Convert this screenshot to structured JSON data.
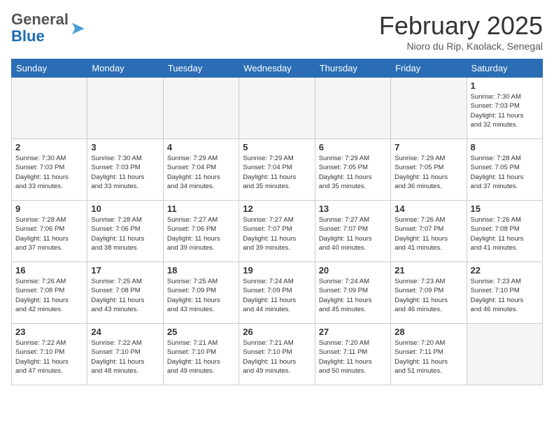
{
  "header": {
    "logo_general": "General",
    "logo_blue": "Blue",
    "month_title": "February 2025",
    "location": "Nioro du Rip, Kaolack, Senegal"
  },
  "weekdays": [
    "Sunday",
    "Monday",
    "Tuesday",
    "Wednesday",
    "Thursday",
    "Friday",
    "Saturday"
  ],
  "weeks": [
    [
      {
        "day": "",
        "info": ""
      },
      {
        "day": "",
        "info": ""
      },
      {
        "day": "",
        "info": ""
      },
      {
        "day": "",
        "info": ""
      },
      {
        "day": "",
        "info": ""
      },
      {
        "day": "",
        "info": ""
      },
      {
        "day": "1",
        "info": "Sunrise: 7:30 AM\nSunset: 7:03 PM\nDaylight: 11 hours\nand 32 minutes."
      }
    ],
    [
      {
        "day": "2",
        "info": "Sunrise: 7:30 AM\nSunset: 7:03 PM\nDaylight: 11 hours\nand 33 minutes."
      },
      {
        "day": "3",
        "info": "Sunrise: 7:30 AM\nSunset: 7:03 PM\nDaylight: 11 hours\nand 33 minutes."
      },
      {
        "day": "4",
        "info": "Sunrise: 7:29 AM\nSunset: 7:04 PM\nDaylight: 11 hours\nand 34 minutes."
      },
      {
        "day": "5",
        "info": "Sunrise: 7:29 AM\nSunset: 7:04 PM\nDaylight: 11 hours\nand 35 minutes."
      },
      {
        "day": "6",
        "info": "Sunrise: 7:29 AM\nSunset: 7:05 PM\nDaylight: 11 hours\nand 35 minutes."
      },
      {
        "day": "7",
        "info": "Sunrise: 7:29 AM\nSunset: 7:05 PM\nDaylight: 11 hours\nand 36 minutes."
      },
      {
        "day": "8",
        "info": "Sunrise: 7:28 AM\nSunset: 7:05 PM\nDaylight: 11 hours\nand 37 minutes."
      }
    ],
    [
      {
        "day": "9",
        "info": "Sunrise: 7:28 AM\nSunset: 7:06 PM\nDaylight: 11 hours\nand 37 minutes."
      },
      {
        "day": "10",
        "info": "Sunrise: 7:28 AM\nSunset: 7:06 PM\nDaylight: 11 hours\nand 38 minutes."
      },
      {
        "day": "11",
        "info": "Sunrise: 7:27 AM\nSunset: 7:06 PM\nDaylight: 11 hours\nand 39 minutes."
      },
      {
        "day": "12",
        "info": "Sunrise: 7:27 AM\nSunset: 7:07 PM\nDaylight: 11 hours\nand 39 minutes."
      },
      {
        "day": "13",
        "info": "Sunrise: 7:27 AM\nSunset: 7:07 PM\nDaylight: 11 hours\nand 40 minutes."
      },
      {
        "day": "14",
        "info": "Sunrise: 7:26 AM\nSunset: 7:07 PM\nDaylight: 11 hours\nand 41 minutes."
      },
      {
        "day": "15",
        "info": "Sunrise: 7:26 AM\nSunset: 7:08 PM\nDaylight: 11 hours\nand 41 minutes."
      }
    ],
    [
      {
        "day": "16",
        "info": "Sunrise: 7:26 AM\nSunset: 7:08 PM\nDaylight: 11 hours\nand 42 minutes."
      },
      {
        "day": "17",
        "info": "Sunrise: 7:25 AM\nSunset: 7:08 PM\nDaylight: 11 hours\nand 43 minutes."
      },
      {
        "day": "18",
        "info": "Sunrise: 7:25 AM\nSunset: 7:09 PM\nDaylight: 11 hours\nand 43 minutes."
      },
      {
        "day": "19",
        "info": "Sunrise: 7:24 AM\nSunset: 7:09 PM\nDaylight: 11 hours\nand 44 minutes."
      },
      {
        "day": "20",
        "info": "Sunrise: 7:24 AM\nSunset: 7:09 PM\nDaylight: 11 hours\nand 45 minutes."
      },
      {
        "day": "21",
        "info": "Sunrise: 7:23 AM\nSunset: 7:09 PM\nDaylight: 11 hours\nand 46 minutes."
      },
      {
        "day": "22",
        "info": "Sunrise: 7:23 AM\nSunset: 7:10 PM\nDaylight: 11 hours\nand 46 minutes."
      }
    ],
    [
      {
        "day": "23",
        "info": "Sunrise: 7:22 AM\nSunset: 7:10 PM\nDaylight: 11 hours\nand 47 minutes."
      },
      {
        "day": "24",
        "info": "Sunrise: 7:22 AM\nSunset: 7:10 PM\nDaylight: 11 hours\nand 48 minutes."
      },
      {
        "day": "25",
        "info": "Sunrise: 7:21 AM\nSunset: 7:10 PM\nDaylight: 11 hours\nand 49 minutes."
      },
      {
        "day": "26",
        "info": "Sunrise: 7:21 AM\nSunset: 7:10 PM\nDaylight: 11 hours\nand 49 minutes."
      },
      {
        "day": "27",
        "info": "Sunrise: 7:20 AM\nSunset: 7:11 PM\nDaylight: 11 hours\nand 50 minutes."
      },
      {
        "day": "28",
        "info": "Sunrise: 7:20 AM\nSunset: 7:11 PM\nDaylight: 11 hours\nand 51 minutes."
      },
      {
        "day": "",
        "info": ""
      }
    ]
  ]
}
